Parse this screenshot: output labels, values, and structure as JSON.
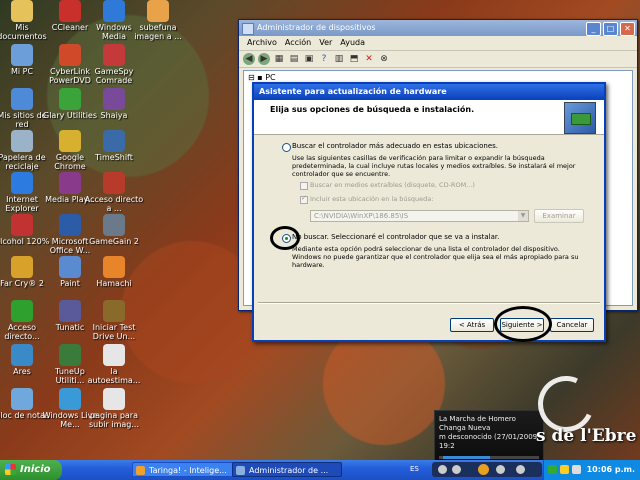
{
  "desktop": {
    "icons": [
      {
        "label": "Mis documentos",
        "icon": "folder-icon",
        "color": "#e6c25a"
      },
      {
        "label": "CCleaner",
        "icon": "ccleaner-icon",
        "color": "#c9302c"
      },
      {
        "label": "Windows Media",
        "icon": "media-player-icon",
        "color": "#2f7ad8"
      },
      {
        "label": "subefuna imagen a ...",
        "icon": "upload-icon",
        "color": "#e8a34a"
      },
      {
        "label": "Mi PC",
        "icon": "computer-icon",
        "color": "#6c9fd9"
      },
      {
        "label": "CyberLink PowerDVD",
        "icon": "powerdvd-icon",
        "color": "#d04a2a"
      },
      {
        "label": "GameSpy Comrade",
        "icon": "gamespy-icon",
        "color": "#c43a3a"
      },
      {
        "label": "Mis sitios de red",
        "icon": "network-icon",
        "color": "#4d8ad8"
      },
      {
        "label": "Glary Utilities",
        "icon": "glary-icon",
        "color": "#3aa33a"
      },
      {
        "label": "Shaiya",
        "icon": "shaiya-icon",
        "color": "#7a4a9a"
      },
      {
        "label": "Papelera de reciclaje",
        "icon": "recycle-bin-icon",
        "color": "#9ab3c8"
      },
      {
        "label": "Google Chrome",
        "icon": "chrome-icon",
        "color": "#d8b02f"
      },
      {
        "label": "TimeShift",
        "icon": "timeshift-icon",
        "color": "#3a6aa8"
      },
      {
        "label": "Internet Explorer",
        "icon": "ie-icon",
        "color": "#2b7be0"
      },
      {
        "label": "Media Play...",
        "icon": "media-play-icon",
        "color": "#8a3a8a"
      },
      {
        "label": "Acceso directo a ...",
        "icon": "shortcut-icon",
        "color": "#b73a2a"
      },
      {
        "label": "Alcohol 120%",
        "icon": "alcohol-icon",
        "color": "#c23232"
      },
      {
        "label": "Microsoft Office W...",
        "icon": "word-icon",
        "color": "#2c5ca8"
      },
      {
        "label": "GameGain 2",
        "icon": "gamegain-icon",
        "color": "#6a7a8a"
      },
      {
        "label": "Far Cry® 2",
        "icon": "farcry-icon",
        "color": "#d8a22a"
      },
      {
        "label": "Paint",
        "icon": "paint-icon",
        "color": "#5a8ad0"
      },
      {
        "label": "Hamachi",
        "icon": "hamachi-icon",
        "color": "#e8852a"
      },
      {
        "label": "Acceso directo...",
        "icon": "shortcut-green-icon",
        "color": "#2da02d"
      },
      {
        "label": "Tunatic",
        "icon": "tunatic-icon",
        "color": "#5a5a9a"
      },
      {
        "label": "Iniciar Test Drive Un...",
        "icon": "testdrive-icon",
        "color": "#8a6a2a"
      },
      {
        "label": "Ares",
        "icon": "ares-icon",
        "color": "#3a8ac8"
      },
      {
        "label": "TuneUp Utiliti...",
        "icon": "tuneup-icon",
        "color": "#3a7a3a"
      },
      {
        "label": "la autoestima...",
        "icon": "document-icon",
        "color": "#e6e6e6"
      },
      {
        "label": "Bloc de notas",
        "icon": "notepad-icon",
        "color": "#6fa8dc"
      },
      {
        "label": "Windows Live Me...",
        "icon": "messenger-icon",
        "color": "#3a9ad8"
      },
      {
        "label": "pagina para subir imag...",
        "icon": "document-icon",
        "color": "#e6e6e6"
      }
    ]
  },
  "devmgr": {
    "title": "Administrador de dispositivos",
    "menu": [
      "Archivo",
      "Acción",
      "Ver",
      "Ayuda"
    ],
    "tree_root": "PC"
  },
  "wizard": {
    "title": "Asistente para actualización de hardware",
    "heading": "Elija sus opciones de búsqueda e instalación.",
    "option1_label": "Buscar el controlador más adecuado en estas ubicaciones.",
    "option1_desc": "Use las siguientes casillas de verificación para limitar o expandir la búsqueda predeterminada, la cual incluye rutas locales y medios extraíbles. Se instalará el mejor controlador que se encuentre.",
    "check1_label": "Buscar en medios extraíbles (disquete, CD-ROM...)",
    "check2_label": "Incluir esta ubicación en la búsqueda:",
    "path_value": "C:\\NVIDIA\\WinXP\\186.85\\IS",
    "browse_label": "Examinar",
    "option2_label": "No buscar. Seleccionaré el controlador que se va a instalar.",
    "option2_desc": "Mediante esta opción podrá seleccionar de una lista el controlador del dispositivo. Windows no puede garantizar que el controlador que elija sea el más apropiado para su hardware.",
    "back_label": "< Atrás",
    "next_label": "Siguiente >",
    "cancel_label": "Cancelar"
  },
  "media": {
    "line1": "La Marcha de Homero",
    "line2": "Changa Nueva",
    "line3": "m desconocido (27/01/2009 19:2"
  },
  "logo": {
    "text": "s de l'Ebre"
  },
  "taskbar": {
    "start_label": "Inicio",
    "tasks": [
      "Taringa! - Intelige...",
      "Administrador de ..."
    ],
    "lang": "ES",
    "clock": "10:06 p.m."
  }
}
